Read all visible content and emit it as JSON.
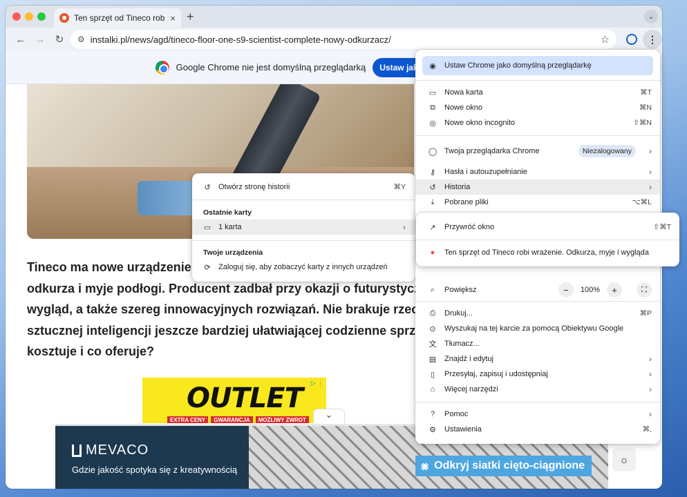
{
  "window": {
    "tab_title": "Ten sprzęt od Tineco robi wrażenie. Odkurza, myje i wygląda",
    "tab_close": "×",
    "new_tab": "+",
    "tab_dropdown": "⌄"
  },
  "toolbar": {
    "url": "instalki.pl/news/agd/tineco-floor-one-s9-scientist-complete-nowy-odkurzacz/"
  },
  "infobar": {
    "message": "Google Chrome nie jest domyślną przeglądarką",
    "button": "Ustaw jako domyślną"
  },
  "article": {
    "lines": [
      "Tineco ma nowe urządzenie wielofunkcyjne, które",
      "odkurza i myje podłogi. Producent zadbał przy okazji o futurystyczny",
      "wygląd, a także szereg innowacyjnych rozwiązań. Nie brakuje rzecz jasna",
      "sztucznej inteligencji jeszcze bardziej ułatwiającej codzienne sprzątanie. Ile",
      "kosztuje i co oferuje?"
    ]
  },
  "ads": {
    "outlet_word": "OUTLET",
    "outlet_strip": [
      "EXTRA CENY",
      "GWARANCJA",
      "MOŻLIWY ZWROT"
    ],
    "outlet_icons": "▷ ⋮",
    "mevaco_logo": "MEVACO",
    "mevaco_tagline": "Gdzie jakość spotyka się z kreatywnością",
    "mesh_cta": "Odkryj siatki cięto-ciągnione"
  },
  "history_submenu": {
    "open_history": "Otwórz stronę historii",
    "open_history_shortcut": "⌘Y",
    "recent_tabs_header": "Ostatnie karty",
    "one_tab": "1 karta",
    "your_devices_header": "Twoje urządzenia",
    "sign_in_prompt": "Zaloguj się, aby zobaczyć karty z innych urządzeń"
  },
  "chrome_menu": {
    "set_default": "Ustaw Chrome jako domyślną przeglądarkę",
    "new_tab": "Nowa karta",
    "new_tab_sc": "⌘T",
    "new_window": "Nowe okno",
    "new_window_sc": "⌘N",
    "incognito": "Nowe okno incognito",
    "incognito_sc": "⇧⌘N",
    "profile": "Twoja przeglądarka Chrome",
    "profile_badge": "Niezalogowany",
    "passwords": "Hasła i autouzupełnianie",
    "history": "Historia",
    "downloads": "Pobrane pliki",
    "downloads_sc": "⌥⌘L",
    "zoom": "Powiększ",
    "zoom_minus": "−",
    "zoom_level": "100%",
    "zoom_plus": "+",
    "print": "Drukuj...",
    "print_sc": "⌘P",
    "lens": "Wyszukaj na tej karcie za pomocą Obiektywu Google",
    "translate": "Tłumacz...",
    "find": "Znajdź i edytuj",
    "cast": "Przesyłaj, zapisuj i udostępniaj",
    "more_tools": "Więcej narzędzi",
    "help": "Pomoc",
    "settings": "Ustawienia",
    "settings_sc": "⌘,"
  },
  "recent_submenu": {
    "restore_window": "Przywróć okno",
    "restore_window_sc": "⇧⌘T",
    "recent_tab": "Ten sprzęt od Tineco robi wrażenie. Odkurza, myje i wygląda"
  },
  "colors": {
    "accent": "#0b57d0",
    "highlight": "#d3e3fd",
    "tineco_favicon": "#e8552e"
  }
}
